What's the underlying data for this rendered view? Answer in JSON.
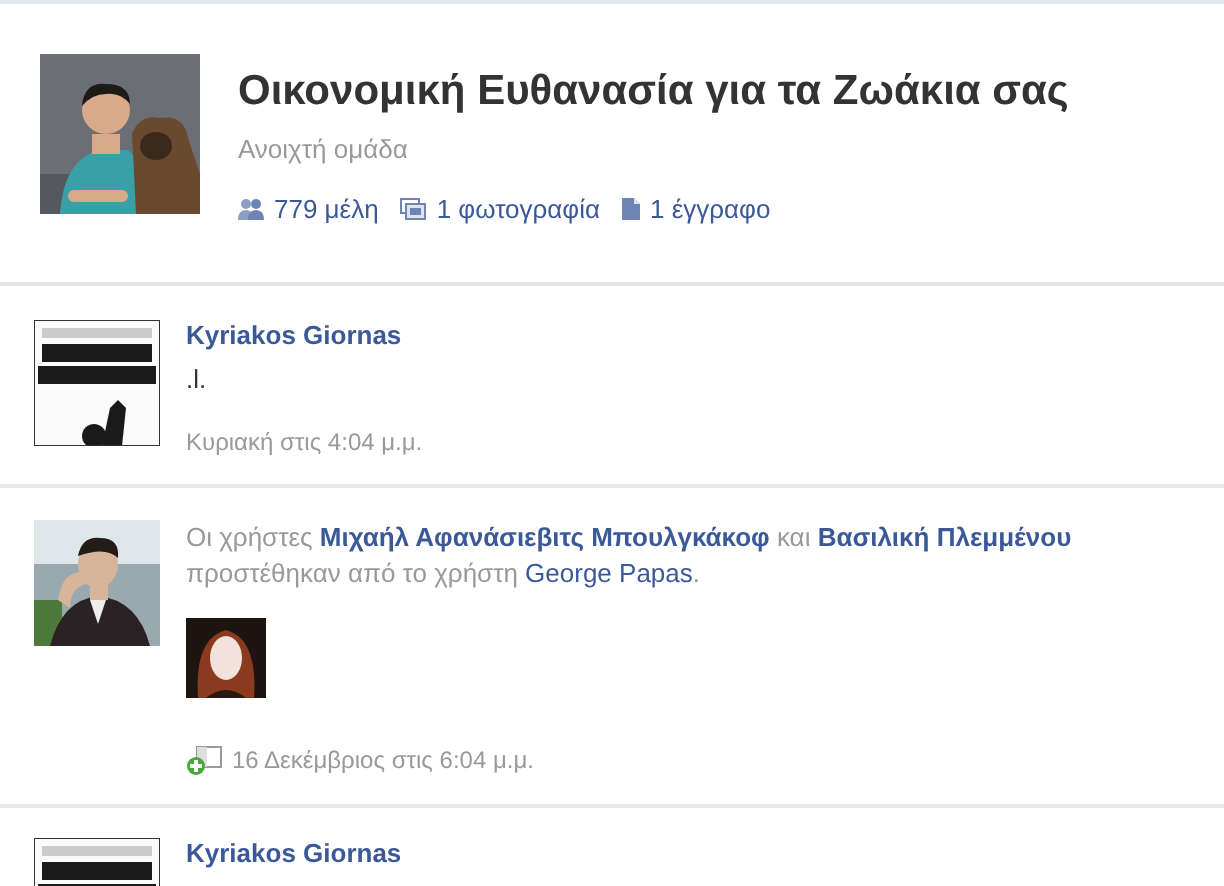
{
  "group": {
    "title": "Οικονομική Ευθανασία για τα Ζωάκια σας",
    "privacy": "Ανοιχτή ομάδα",
    "stats": [
      {
        "kind": "members",
        "text": "779 μέλη"
      },
      {
        "kind": "photos",
        "text": "1 φωτογραφία"
      },
      {
        "kind": "documents",
        "text": "1 έγγραφο"
      }
    ]
  },
  "posts": [
    {
      "kind": "status",
      "author": "Kyriakos Giornas",
      "text": ".l.",
      "time": "Κυριακή στις 4:04 μ.μ."
    },
    {
      "kind": "members_added",
      "parts": [
        {
          "kind": "text",
          "text": "Οι χρήστες "
        },
        {
          "kind": "bold-link",
          "text": "Μιχαήλ Αφανάσιεβιτς Μπουλγκάκοφ"
        },
        {
          "kind": "text",
          "text": " και "
        },
        {
          "kind": "bold-link",
          "text": "Βασιλική Πλεμμένου"
        },
        {
          "kind": "text",
          "text": " προστέθηκαν από το χρήστη "
        },
        {
          "kind": "link",
          "text": "George Papas"
        },
        {
          "kind": "text",
          "text": "."
        }
      ],
      "time": "16 Δεκέμβριος στις 6:04 μ.μ."
    },
    {
      "kind": "status",
      "author": "Kyriakos Giornas"
    }
  ]
}
